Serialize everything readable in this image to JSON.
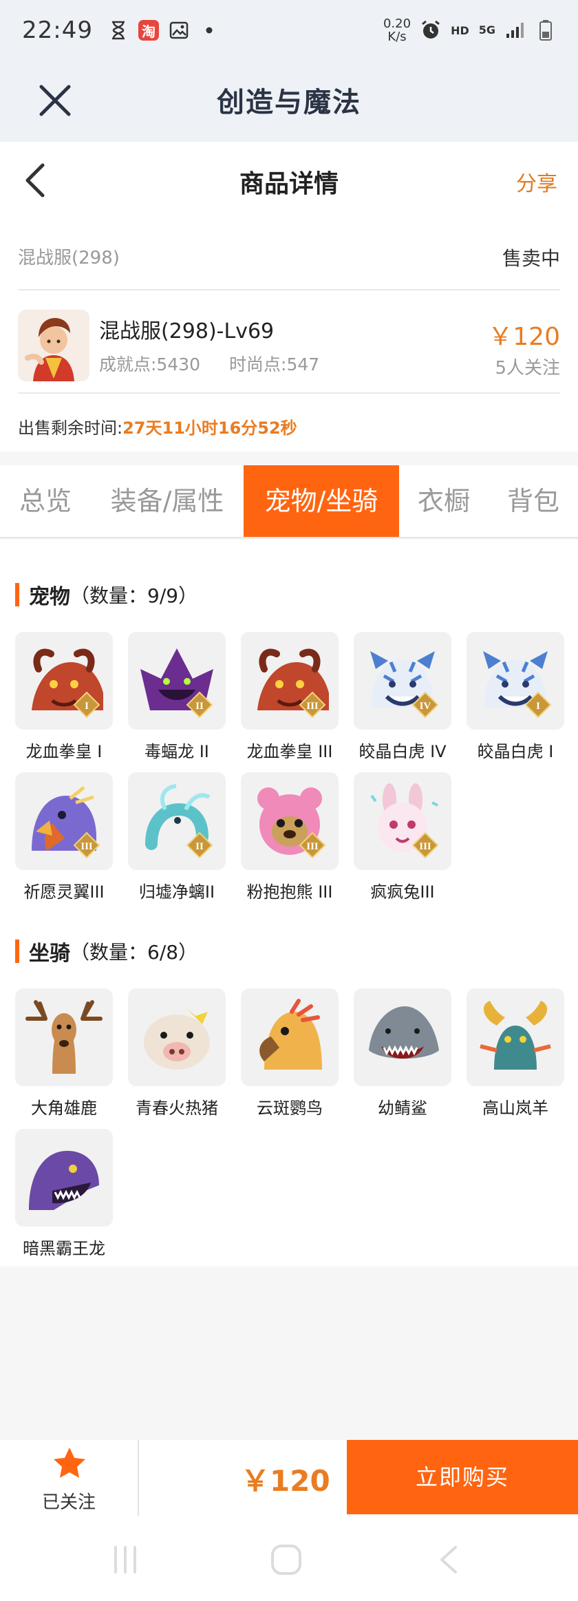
{
  "status_bar": {
    "time": "22:49",
    "net_speed_value": "0.20",
    "net_speed_unit": "K/s",
    "hd": "HD",
    "network": "5G"
  },
  "app": {
    "title": "创造与魔法"
  },
  "nav": {
    "title": "商品详情",
    "share_label": "分享"
  },
  "listing": {
    "server": "混战服(298)",
    "status": "售卖中",
    "name": "混战服(298)-Lv69",
    "achievement_label": "成就点:5430",
    "fashion_label": "时尚点:547",
    "price": "￥120",
    "followers": "5人关注",
    "remain_label": "出售剩余时间:",
    "remain_value": "27天11小时16分52秒"
  },
  "tabs": [
    {
      "label": "总览"
    },
    {
      "label": "装备/属性"
    },
    {
      "label": "宠物/坐骑"
    },
    {
      "label": "衣橱"
    },
    {
      "label": "背包"
    }
  ],
  "active_tab": "宠物/坐骑",
  "pets": {
    "title": "宠物",
    "count": "（数量：9/9）",
    "items": [
      {
        "name": "龙血拳皇 I",
        "icon": "dragon-fist-icon",
        "color": "#c0462c",
        "badge": "I"
      },
      {
        "name": "毒蝠龙 II",
        "icon": "poison-bat-dragon-icon",
        "color": "#6b2d8f",
        "badge": "II"
      },
      {
        "name": "龙血拳皇 III",
        "icon": "dragon-fist-icon",
        "color": "#c0462c",
        "badge": "III"
      },
      {
        "name": "皎晶白虎 IV",
        "icon": "crystal-tiger-icon",
        "color": "#4d7fd1",
        "badge": "IV"
      },
      {
        "name": "皎晶白虎 I",
        "icon": "crystal-tiger-icon",
        "color": "#4d7fd1",
        "badge": "I"
      },
      {
        "name": "祈愿灵翼III",
        "icon": "wish-wing-bird-icon",
        "color": "#e06a2a",
        "badge": "III"
      },
      {
        "name": "归墟净螭II",
        "icon": "jade-dragon-icon",
        "color": "#5cc2c9",
        "badge": "II"
      },
      {
        "name": "粉抱抱熊 III",
        "icon": "pink-bear-icon",
        "color": "#f08ab8",
        "badge": "III"
      },
      {
        "name": "疯疯兔III",
        "icon": "crazy-rabbit-icon",
        "color": "#f2c7d8",
        "badge": "III"
      }
    ]
  },
  "mounts": {
    "title": "坐骑",
    "count": "（数量：6/8）",
    "items": [
      {
        "name": "大角雄鹿",
        "icon": "stag-icon",
        "color": "#c98b4f"
      },
      {
        "name": "青春火热猪",
        "icon": "pig-icon",
        "color": "#efe3d6"
      },
      {
        "name": "云斑鹦鸟",
        "icon": "parrot-icon",
        "color": "#f0b24a"
      },
      {
        "name": "幼鲭鲨",
        "icon": "shark-icon",
        "color": "#7f8a94"
      },
      {
        "name": "高山岚羊",
        "icon": "mountain-goat-icon",
        "color": "#3f8a8c"
      },
      {
        "name": "暗黑霸王龙",
        "icon": "dark-trex-icon",
        "color": "#6a4aa6"
      }
    ]
  },
  "action_bar": {
    "follow_label": "已关注",
    "price": "￥120",
    "buy_label": "立即购买"
  },
  "colors": {
    "accent": "#ff6511",
    "price": "#e97c21"
  }
}
